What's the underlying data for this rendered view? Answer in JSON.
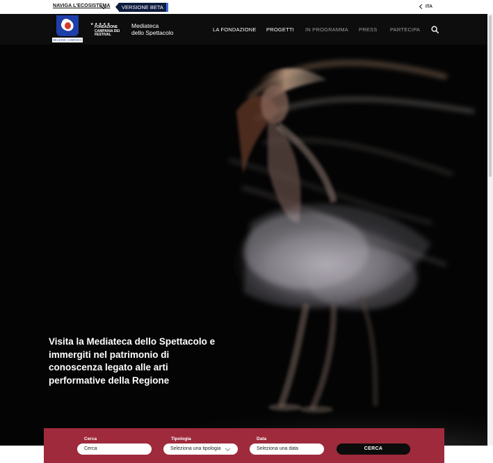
{
  "topbar": {
    "ecosystem_link": "NAVIGA L'ECOSISTEMA",
    "beta_badge": "VERSIONE BETA",
    "language": "ITA"
  },
  "header": {
    "region_logo_text": "REGIONE CAMPANIA",
    "fcf_logo_text": "FONDAZIONE CAMPANIA DEI FESTIVAL",
    "site_title_line1": "Mediateca",
    "site_title_line2": "dello Spettacolo",
    "nav": [
      {
        "label": "LA FONDAZIONE"
      },
      {
        "label": "PROGETTI"
      },
      {
        "label": "IN PROGRAMMA"
      },
      {
        "label": "PRESS"
      },
      {
        "label": "PARTECIPA"
      }
    ]
  },
  "hero": {
    "headline": "Visita la Mediateca dello Spettacolo e immergiti nel patrimonio di conoscenza legato alle arti performative della Regione"
  },
  "search": {
    "cerca_label": "Cerca",
    "cerca_value": "Cerca",
    "tipologia_label": "Tipologia",
    "tipologia_value": "Seleziona una tipologia",
    "data_label": "Data",
    "data_value": "Seleziona una data",
    "submit_label": "CERCA"
  },
  "colors": {
    "search_panel": "#9f2a3b",
    "beta_badge": "#0d1b3e",
    "region_blue": "#1e3ea8"
  }
}
